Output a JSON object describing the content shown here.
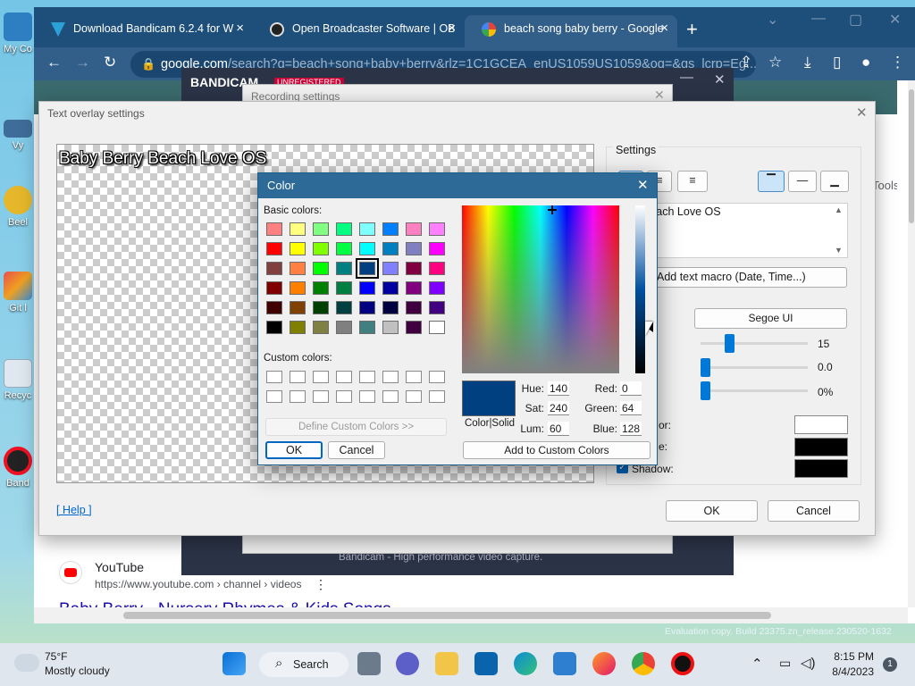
{
  "desktop": {
    "icons": [
      {
        "label": "My Co"
      },
      {
        "label": "Vy"
      },
      {
        "label": "Beel"
      },
      {
        "label": "Git l"
      },
      {
        "label": "Recyc"
      },
      {
        "label": "Band"
      }
    ]
  },
  "browser": {
    "tabs": [
      {
        "title": "Download Bandicam 6.2.4 for W",
        "icon": "bandicam-icon"
      },
      {
        "title": "Open Broadcaster Software | OB",
        "icon": "obs-icon"
      },
      {
        "title": "beach song baby berry - Google",
        "icon": "google-icon"
      }
    ],
    "new_tab": "+",
    "url_host": "google.com",
    "url_rest": "/search?q=beach+song+baby+berry&rlz=1C1GCEA_enUS1059US1059&oq=&gs_lcrp=Eg...",
    "right_partial_text": "Tools",
    "result": {
      "site": "YouTube",
      "url": "https://www.youtube.com › channel › videos",
      "title": "Baby Berry - Nursery Rhymes & Kids Songs"
    }
  },
  "bandicam": {
    "logo": "BANDICAM",
    "badge": "UNREGISTERED",
    "recording_title": "Recording settings",
    "footer": "Bandicam - High performance video capture."
  },
  "text_overlay": {
    "title": "Text overlay settings",
    "preview_text": "Baby Berry Beach Love OS",
    "settings_label": "Settings",
    "textbox_text": "erry Beach Love OS",
    "macro_button": "Add text macro (Date, Time...)",
    "font_button": "Segoe UI",
    "size_value": "15",
    "second_value": "0.0",
    "third_value": "0%",
    "color_label": "or:",
    "outline_label": "e:",
    "shadow_label": "Shadow:",
    "text_color": "#ffffff",
    "outline_color": "#000000",
    "shadow_color": "#000000",
    "help_link": "[ Help ]",
    "ok": "OK",
    "cancel": "Cancel"
  },
  "color_dialog": {
    "title": "Color",
    "basic_colors_label": "Basic colors:",
    "basic_colors": [
      "#ff8080",
      "#ffff80",
      "#80ff80",
      "#00ff80",
      "#80ffff",
      "#0080ff",
      "#ff80c0",
      "#ff80ff",
      "#ff0000",
      "#ffff00",
      "#80ff00",
      "#00ff40",
      "#00ffff",
      "#0080c0",
      "#8080c0",
      "#ff00ff",
      "#804040",
      "#ff8040",
      "#00ff00",
      "#008080",
      "#004080",
      "#8080ff",
      "#800040",
      "#ff0080",
      "#800000",
      "#ff8000",
      "#008000",
      "#008040",
      "#0000ff",
      "#0000a0",
      "#800080",
      "#8000ff",
      "#400000",
      "#804000",
      "#004000",
      "#004040",
      "#000080",
      "#000040",
      "#400040",
      "#400080",
      "#000000",
      "#808000",
      "#808040",
      "#808080",
      "#408080",
      "#c0c0c0",
      "#400040",
      "#ffffff"
    ],
    "selected_index": 20,
    "custom_colors_label": "Custom colors:",
    "define_custom": "Define Custom Colors >>",
    "ok": "OK",
    "cancel": "Cancel",
    "color_solid_label": "Color|Solid",
    "current_color": "#004080",
    "hue_label": "Hue:",
    "hue": "140",
    "sat_label": "Sat:",
    "sat": "240",
    "lum_label": "Lum:",
    "lum": "60",
    "red_label": "Red:",
    "red": "0",
    "green_label": "Green:",
    "green": "64",
    "blue_label": "Blue:",
    "blue": "128",
    "add_custom": "Add to Custom Colors"
  },
  "watermark": "Evaluation copy. Build 23375.zn_release.230520-1632",
  "taskbar": {
    "weather_temp": "75°F",
    "weather_desc": "Mostly cloudy",
    "search_label": "Search",
    "time": "8:15 PM",
    "date": "8/4/2023",
    "notification_count": "1"
  }
}
